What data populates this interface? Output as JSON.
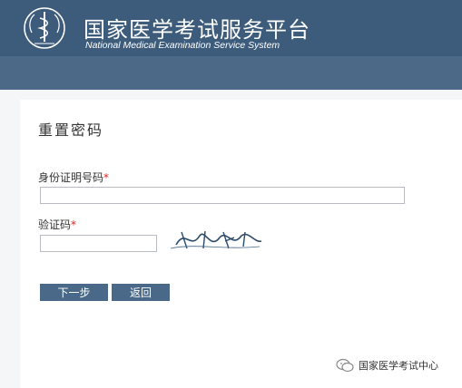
{
  "header": {
    "title_cn": "国家医学考试服务平台",
    "title_en": "National Medical Examination Service System",
    "logo_icon": "medical-caduceus-emblem"
  },
  "form": {
    "title": "重置密码",
    "id_label": "身份证明号码",
    "captcha_label": "验证码",
    "required_mark": "*",
    "id_value": "",
    "captcha_value": "",
    "next_button": "下一步",
    "back_button": "返回"
  },
  "watermark": {
    "text": "国家医学考试中心",
    "icon": "wechat-icon"
  },
  "colors": {
    "header": "#3d5c7c",
    "button": "#4a6988",
    "required": "#d22222"
  }
}
